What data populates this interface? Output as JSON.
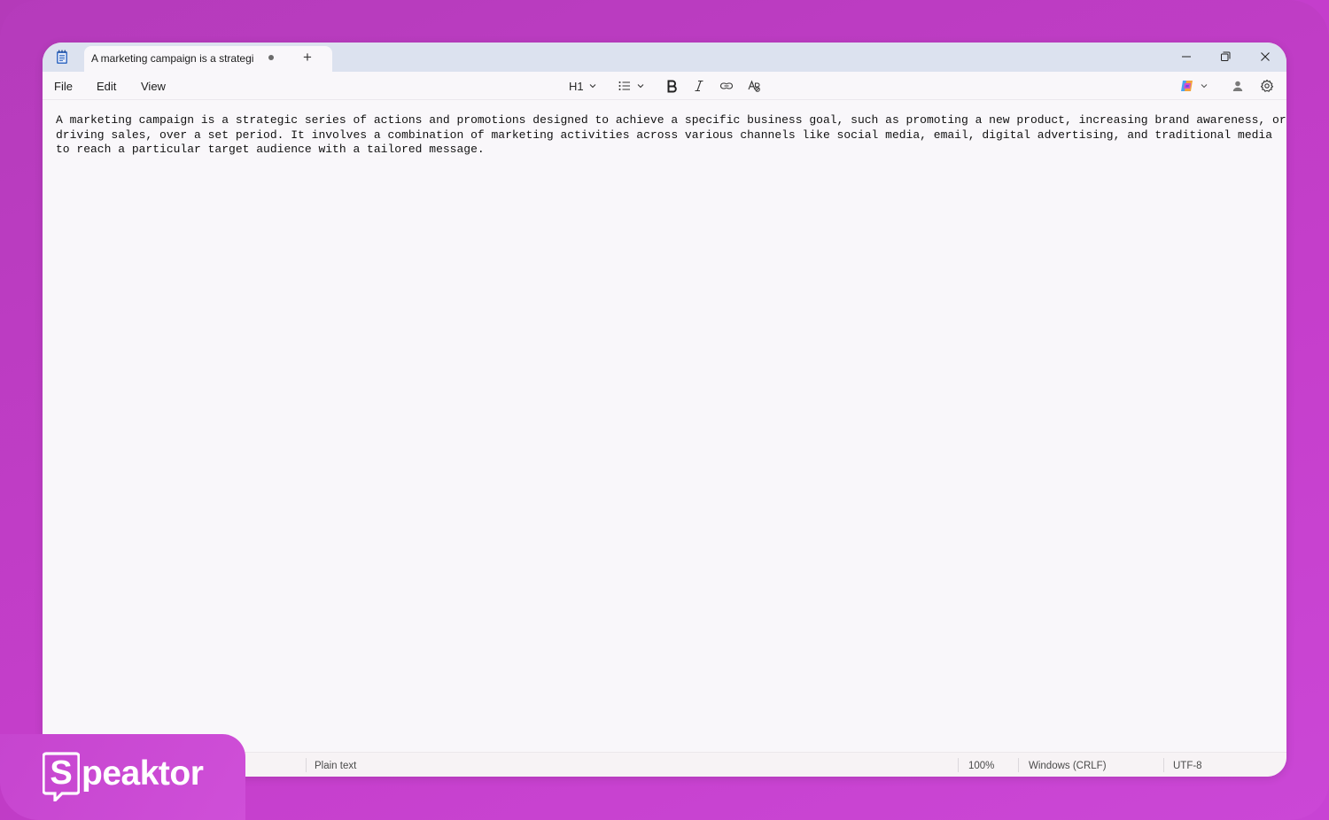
{
  "window": {
    "tab_title": "A marketing campaign is a strategi",
    "new_tab_label": "+"
  },
  "menu": {
    "file": "File",
    "edit": "Edit",
    "view": "View"
  },
  "toolbar": {
    "heading": "H1"
  },
  "editor": {
    "line1": "A marketing campaign is a strategic series of actions and promotions designed to achieve a specific business goal, such as promoting a new product, increasing brand awareness, or",
    "line2": "driving sales, over a set period. It involves a combination of marketing activities across various channels like social media, email, digital advertising, and traditional media",
    "line3": "to reach a particular target audience with a tailored message."
  },
  "status": {
    "format": "Plain text",
    "zoom": "100%",
    "line_ending": "Windows (CRLF)",
    "encoding": "UTF-8"
  },
  "brand": {
    "logo_letter": "S",
    "logo_text": "peaktor"
  },
  "icons": {
    "app": "notepad-icon",
    "minimize": "minimize-icon",
    "maximize": "restore-icon",
    "close": "close-icon",
    "list": "bulleted-list-icon",
    "bold": "bold-icon",
    "italic": "italic-icon",
    "link": "link-icon",
    "clear_format": "clear-formatting-icon",
    "copilot": "copilot-icon",
    "account": "account-icon",
    "settings": "gear-icon"
  },
  "colors": {
    "background": "#c23cc9",
    "titlebar": "#dce2ef",
    "editor": "#f9f7fa"
  }
}
